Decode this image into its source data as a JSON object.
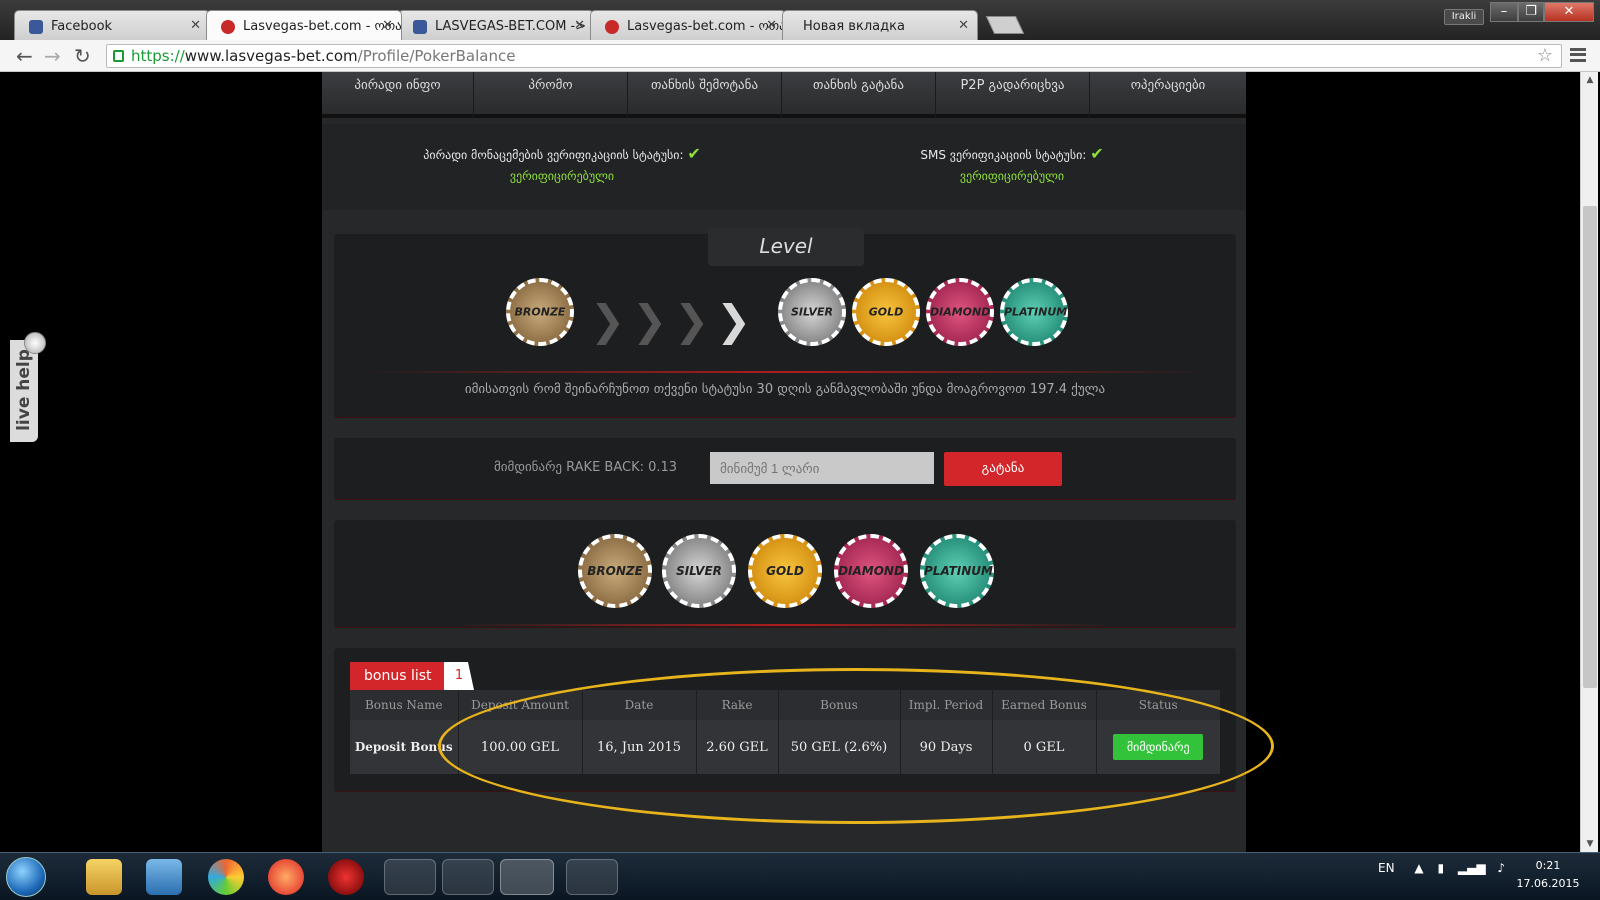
{
  "browser": {
    "tabs": [
      {
        "title": "Facebook",
        "favicon_color": "#3b5998",
        "active": false
      },
      {
        "title": "Lasvegas-bet.com - ოთამ",
        "favicon_color": "#c82a2a",
        "active": true
      },
      {
        "title": "LASVEGAS-BET.COM -> ოთ",
        "favicon_color": "#3b5998",
        "active": false
      },
      {
        "title": "Lasvegas-bet.com - ოთამ",
        "favicon_color": "#c82a2a",
        "active": false
      },
      {
        "title": "Новая вкладка",
        "favicon_color": "",
        "active": false
      }
    ],
    "user_badge": "Irakli",
    "url_scheme": "https://",
    "url_host": "www.lasvegas-bet.com",
    "url_path": "/Profile/PokerBalance"
  },
  "live_help": "live help",
  "menu": [
    "პირადი ინფო",
    "პრომო",
    "თანხის შემოტანა",
    "თანხის გატანა",
    "P2P გადარიცხვა",
    "ოპერაციები"
  ],
  "verification": {
    "personal_label": "პირადი მონაცემების ვერიფიკაციის სტატუსი:",
    "personal_state": "ვერიფიცირებული",
    "sms_label": "SMS ვერიფიკაციის სტატუსი:",
    "sms_state": "ვერიფიცირებული",
    "check_glyph": "✔"
  },
  "level": {
    "title": "Level",
    "current": "BRONZE",
    "chips": [
      "SILVER",
      "GOLD",
      "DIAMOND",
      "PLATINUM"
    ],
    "note": "იმისათვის რომ შეინარჩუნოთ თქვენი სტატუსი 30 დღის განმავლობაში უნდა მოაგროვოთ 197.4 ქულა"
  },
  "rake": {
    "label": "მიმდინარე RAKE BACK: 0.13",
    "input_placeholder": "მინიმუმ 1 ლარი",
    "button": "გატანა"
  },
  "chip_row": [
    "BRONZE",
    "SILVER",
    "GOLD",
    "DIAMOND",
    "PLATINUM"
  ],
  "bonus": {
    "tab_label": "bonus list",
    "count": "1",
    "columns": [
      "Bonus Name",
      "Deposit Amount",
      "Date",
      "Rake",
      "Bonus",
      "Impl. Period",
      "Earned Bonus",
      "Status"
    ],
    "rows": [
      {
        "name": "Deposit Bonus",
        "deposit": "100.00 GEL",
        "date": "16, Jun 2015",
        "rake": "2.60 GEL",
        "bonus": "50 GEL (2.6%)",
        "period": "90 Days",
        "earned": "0 GEL",
        "status": "მიმდინარე"
      }
    ]
  },
  "taskbar": {
    "lang": "EN",
    "time": "0:21",
    "date": "17.06.2015"
  },
  "colors": {
    "accent_red": "#d3262b",
    "verified_green": "#8ee03a",
    "status_green": "#33c33a",
    "highlight": "#e7b41c"
  }
}
